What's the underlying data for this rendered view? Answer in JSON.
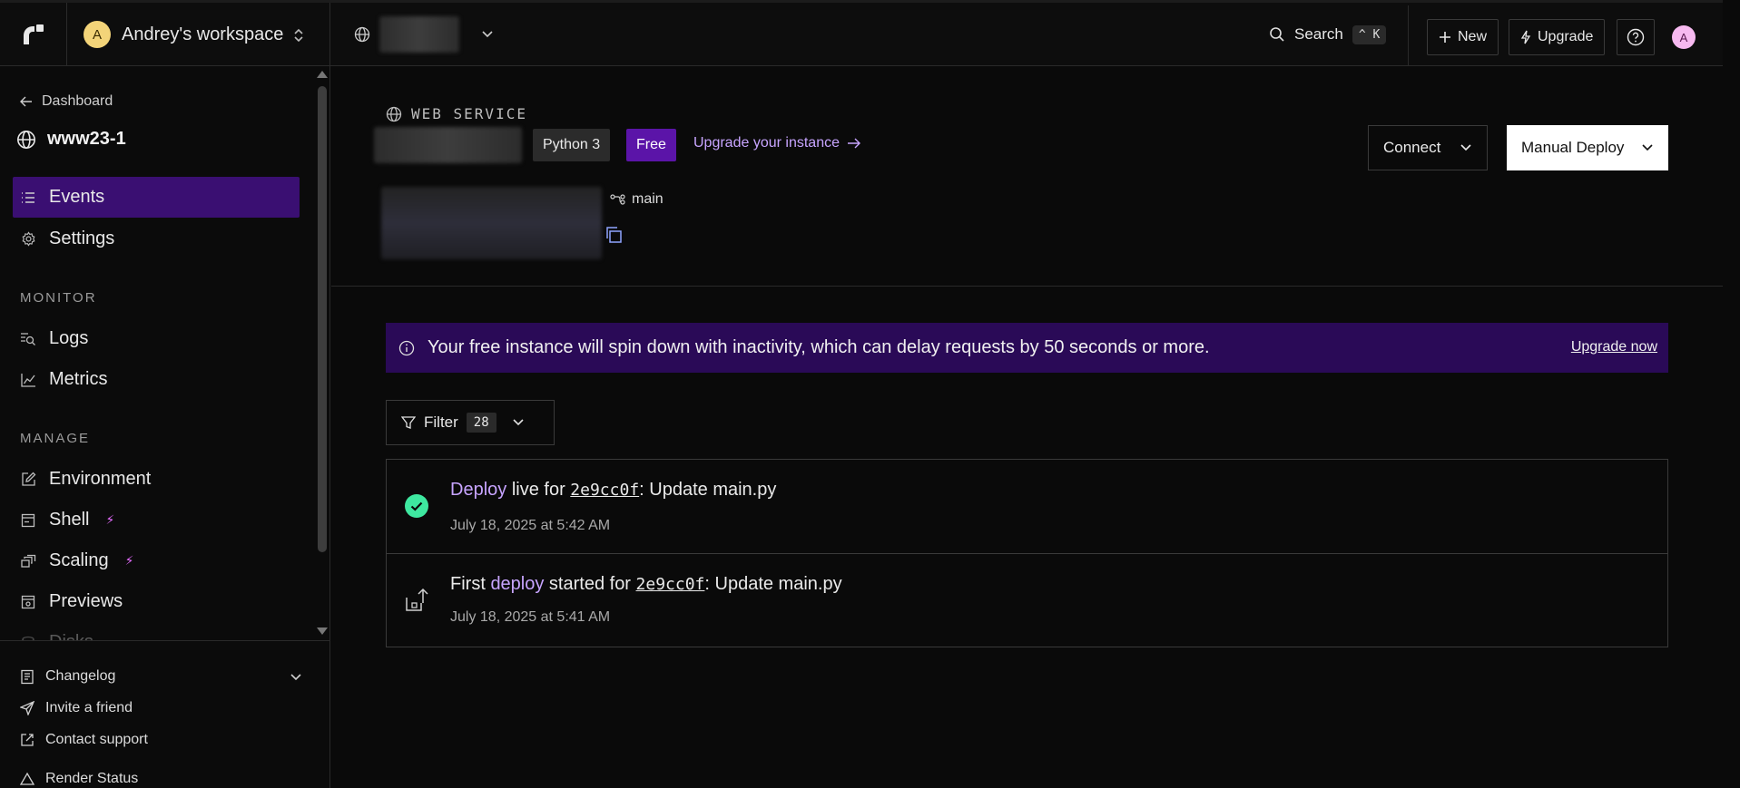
{
  "colors": {
    "accent": "#3a0f72",
    "link": "#c7a4ff",
    "success": "#3ee8a0",
    "banner": "#2a0a57",
    "free_badge": "#5b14a8"
  },
  "topbar": {
    "workspace_initial": "A",
    "workspace_name": "Andrey's workspace",
    "search_label": "Search",
    "search_shortcut": "^ K",
    "new_label": "New",
    "upgrade_label": "Upgrade",
    "user_initial": "A"
  },
  "sidebar": {
    "back_label": "Dashboard",
    "service_name": "www23-1",
    "nav": [
      {
        "label": "Events",
        "icon": "list-icon",
        "active": true
      },
      {
        "label": "Settings",
        "icon": "gear-icon",
        "active": false
      }
    ],
    "monitor_title": "MONITOR",
    "monitor_items": [
      {
        "label": "Logs",
        "icon": "logs-icon"
      },
      {
        "label": "Metrics",
        "icon": "chart-icon"
      }
    ],
    "manage_title": "MANAGE",
    "manage_items": [
      {
        "label": "Environment",
        "icon": "edit-icon"
      },
      {
        "label": "Shell",
        "icon": "terminal-icon"
      },
      {
        "label": "Scaling",
        "icon": "scaling-icon"
      },
      {
        "label": "Previews",
        "icon": "previews-icon"
      },
      {
        "label": "Disks",
        "icon": "disk-icon"
      }
    ],
    "footer": [
      {
        "label": "Changelog",
        "icon": "book-icon"
      },
      {
        "label": "Invite a friend",
        "icon": "send-icon"
      },
      {
        "label": "Contact support",
        "icon": "external-icon"
      },
      {
        "label": "Render Status",
        "icon": "status-icon"
      }
    ]
  },
  "service": {
    "type_label": "WEB SERVICE",
    "runtime": "Python 3",
    "plan": "Free",
    "upgrade_link": "Upgrade your instance",
    "branch": "main",
    "connect_label": "Connect",
    "manual_deploy_label": "Manual Deploy"
  },
  "banner": {
    "message": "Your free instance will spin down with inactivity, which can delay requests by 50 seconds or more.",
    "link": "Upgrade now"
  },
  "filter": {
    "label": "Filter",
    "count": "28"
  },
  "events": [
    {
      "pre": "",
      "link_word": "Deploy",
      "mid": " live for ",
      "commit": "2e9cc0f",
      "post": ": Update main.py",
      "time": "July 18, 2025 at 5:42 AM",
      "icon": "check-circle-icon"
    },
    {
      "pre": "First ",
      "link_word": "deploy",
      "mid": " started for ",
      "commit": "2e9cc0f",
      "post": ": Update main.py",
      "time": "July 18, 2025 at 5:41 AM",
      "icon": "deploy-upload-icon"
    }
  ]
}
